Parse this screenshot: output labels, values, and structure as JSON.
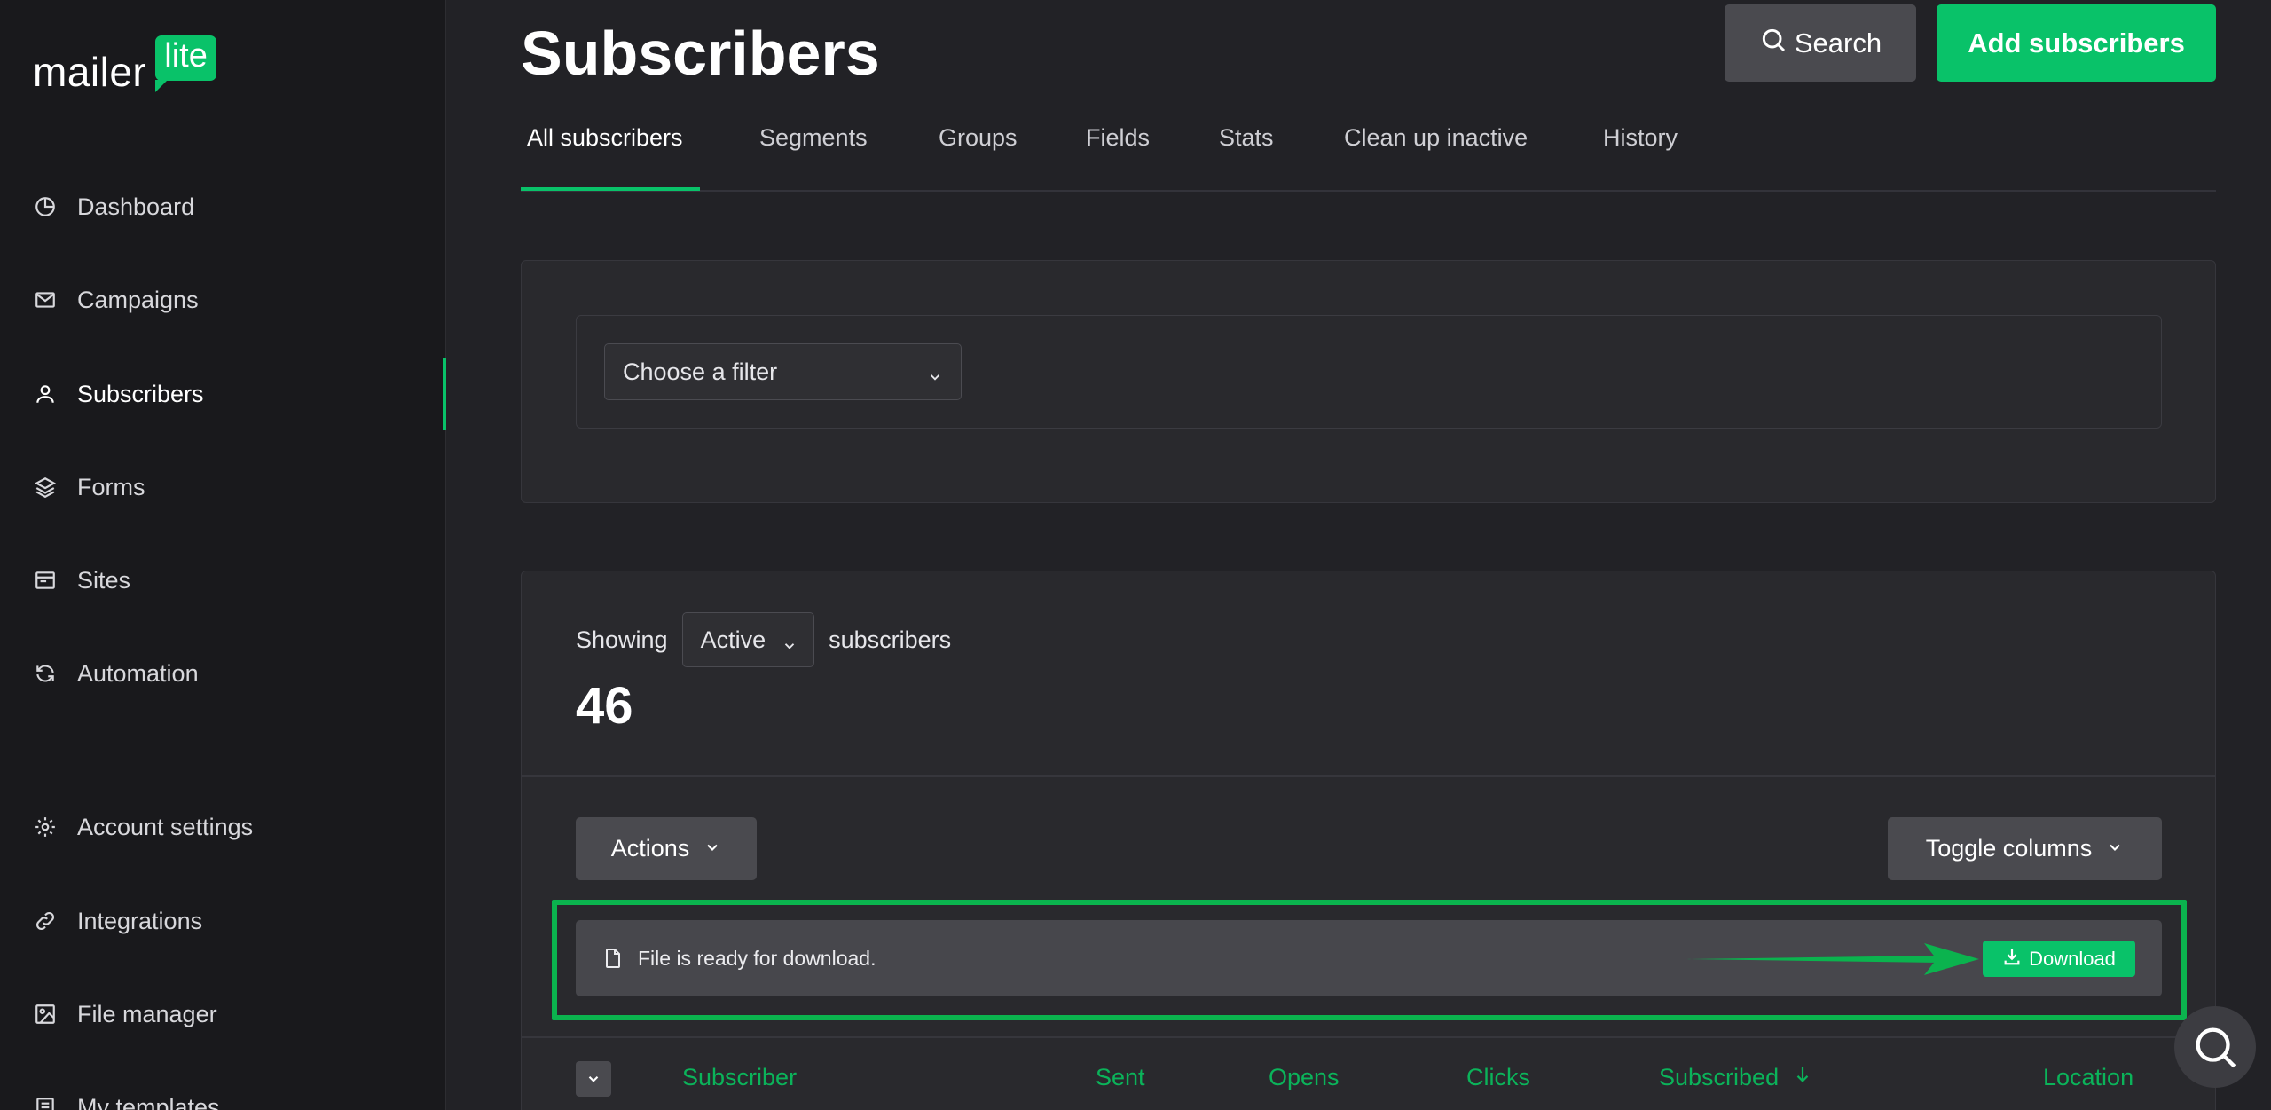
{
  "brand": {
    "word": "mailer",
    "badge": "lite",
    "accent": "#09c269"
  },
  "sidebar": {
    "items": [
      {
        "label": "Dashboard",
        "icon": "dashboard-icon"
      },
      {
        "label": "Campaigns",
        "icon": "envelope-icon"
      },
      {
        "label": "Subscribers",
        "icon": "user-icon",
        "active": true
      },
      {
        "label": "Forms",
        "icon": "layers-icon"
      },
      {
        "label": "Sites",
        "icon": "browser-icon"
      },
      {
        "label": "Automation",
        "icon": "refresh-icon"
      },
      {
        "label": "Account settings",
        "icon": "gear-icon"
      },
      {
        "label": "Integrations",
        "icon": "link-icon"
      },
      {
        "label": "File manager",
        "icon": "image-icon"
      },
      {
        "label": "My templates",
        "icon": "template-icon"
      }
    ]
  },
  "header": {
    "title": "Subscribers",
    "search_label": "Search",
    "add_label": "Add subscribers"
  },
  "tabs": [
    {
      "label": "All subscribers",
      "active": true
    },
    {
      "label": "Segments"
    },
    {
      "label": "Groups"
    },
    {
      "label": "Fields"
    },
    {
      "label": "Stats"
    },
    {
      "label": "Clean up inactive"
    },
    {
      "label": "History"
    }
  ],
  "filter": {
    "placeholder": "Choose a filter"
  },
  "summary": {
    "prefix": "Showing",
    "status": "Active",
    "suffix": "subscribers",
    "count": "46"
  },
  "toolbar": {
    "actions_label": "Actions",
    "toggle_label": "Toggle columns"
  },
  "download": {
    "message": "File is ready for download.",
    "button_label": "Download"
  },
  "table": {
    "columns": [
      "Subscriber",
      "Sent",
      "Opens",
      "Clicks",
      "Subscribed",
      "Location"
    ],
    "sorted_column": "Subscribed",
    "sort_direction": "descending"
  }
}
